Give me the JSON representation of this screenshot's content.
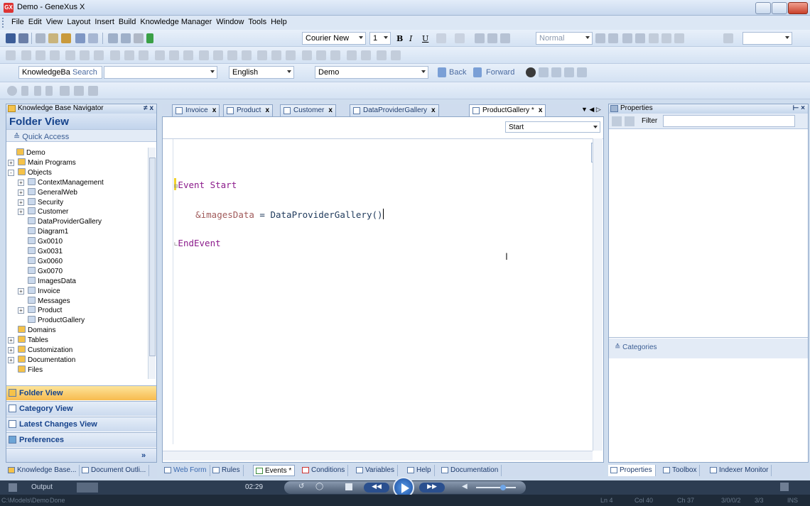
{
  "window": {
    "title": "Demo - GeneXus X",
    "app_icon": "GX"
  },
  "menu": [
    "File",
    "Edit",
    "View",
    "Layout",
    "Insert",
    "Build",
    "Knowledge Manager",
    "Window",
    "Tools",
    "Help"
  ],
  "toolbar1": {
    "font": "Courier New",
    "size": "1",
    "style": "Normal"
  },
  "toolbar3": {
    "kb_combo": "KnowledgeBa",
    "search": "Search",
    "language": "English",
    "env": "Demo",
    "back": "Back",
    "forward": "Forward"
  },
  "left_panel": {
    "title": "Knowledge Base Navigator",
    "pin": "≠ x",
    "folder_view_title": "Folder View",
    "quick_access": "Quick Access",
    "tree": [
      {
        "label": "Demo",
        "level": 0,
        "pm": ""
      },
      {
        "label": "Main Programs",
        "level": 1,
        "pm": "+"
      },
      {
        "label": "Objects",
        "level": 1,
        "pm": "-"
      },
      {
        "label": "ContextManagement",
        "level": 2,
        "pm": "+"
      },
      {
        "label": "GeneralWeb",
        "level": 2,
        "pm": "+"
      },
      {
        "label": "Security",
        "level": 2,
        "pm": "+"
      },
      {
        "label": "Customer",
        "level": 2,
        "pm": "+"
      },
      {
        "label": "DataProviderGallery",
        "level": 2,
        "pm": ""
      },
      {
        "label": "Diagram1",
        "level": 2,
        "pm": ""
      },
      {
        "label": "Gx0010",
        "level": 2,
        "pm": ""
      },
      {
        "label": "Gx0031",
        "level": 2,
        "pm": ""
      },
      {
        "label": "Gx0060",
        "level": 2,
        "pm": ""
      },
      {
        "label": "Gx0070",
        "level": 2,
        "pm": ""
      },
      {
        "label": "ImagesData",
        "level": 2,
        "pm": ""
      },
      {
        "label": "Invoice",
        "level": 2,
        "pm": "+"
      },
      {
        "label": "Messages",
        "level": 2,
        "pm": ""
      },
      {
        "label": "Product",
        "level": 2,
        "pm": "+"
      },
      {
        "label": "ProductGallery",
        "level": 2,
        "pm": ""
      },
      {
        "label": "Domains",
        "level": 1,
        "pm": ""
      },
      {
        "label": "Tables",
        "level": 1,
        "pm": "+"
      },
      {
        "label": "Customization",
        "level": 1,
        "pm": "+"
      },
      {
        "label": "Documentation",
        "level": 1,
        "pm": "+"
      },
      {
        "label": "Files",
        "level": 1,
        "pm": ""
      }
    ],
    "nav_buttons": [
      "Folder View",
      "Category View",
      "Latest Changes View",
      "Preferences"
    ]
  },
  "editor": {
    "tabs": [
      {
        "label": "Invoice",
        "active": false
      },
      {
        "label": "Product",
        "active": false
      },
      {
        "label": "Customer",
        "active": false
      },
      {
        "label": "DataProviderGallery",
        "active": false
      },
      {
        "label": "ProductGallery *",
        "active": true
      }
    ],
    "event_combo": "Start",
    "code_line1_kw": "Event",
    "code_line1_rest": " Start",
    "code_line2_var": "&imagesData",
    "code_line2_rest": " = DataProviderGallery()",
    "code_line3": "EndEvent",
    "bottom_tabs": [
      "Web Form",
      "Rules",
      "Events *",
      "Conditions",
      "Variables",
      "Help",
      "Documentation"
    ]
  },
  "right_panel": {
    "title": "Properties",
    "filter": "Filter",
    "categories": "Categories",
    "bottom_tabs": [
      "Properties",
      "Toolbox",
      "Indexer Monitor"
    ]
  },
  "bottom_left_tabs": [
    "Knowledge Base...",
    "Document Outli..."
  ],
  "status": {
    "output": "Output",
    "time": "02:29",
    "path": "C:\\Models\\Demo",
    "done": "Done",
    "ln": "Ln 4",
    "col": "Col 40",
    "ch": "Ch 37",
    "date": "3/0/0/2",
    "frac": "3/3",
    "ins": "INS"
  }
}
